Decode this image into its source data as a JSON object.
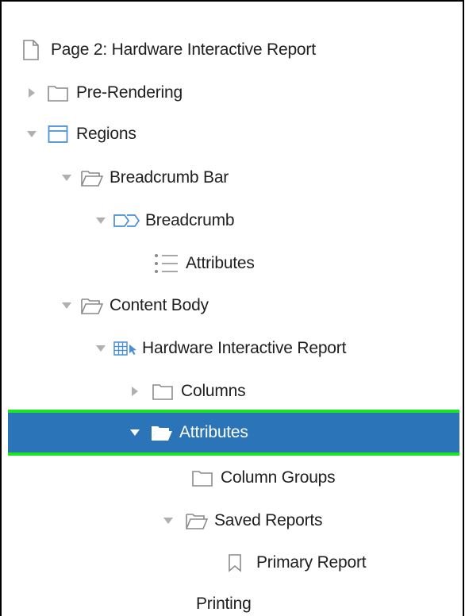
{
  "tree": {
    "nodes": [
      {
        "label": "Page 2: Hardware Interactive Report",
        "icon": "page-icon",
        "toggle": "none"
      },
      {
        "label": "Pre-Rendering",
        "icon": "folder-icon",
        "toggle": "collapsed"
      },
      {
        "label": "Regions",
        "icon": "region-icon",
        "toggle": "expanded"
      },
      {
        "label": "Breadcrumb Bar",
        "icon": "folder-open-icon",
        "toggle": "expanded"
      },
      {
        "label": "Breadcrumb",
        "icon": "breadcrumb-icon",
        "toggle": "expanded"
      },
      {
        "label": "Attributes",
        "icon": "list-icon",
        "toggle": "none"
      },
      {
        "label": "Content Body",
        "icon": "folder-open-icon",
        "toggle": "expanded"
      },
      {
        "label": "Hardware Interactive Report",
        "icon": "interactive-report-icon",
        "toggle": "expanded"
      },
      {
        "label": "Columns",
        "icon": "folder-icon",
        "toggle": "collapsed"
      },
      {
        "label": "Attributes",
        "icon": "folder-open-icon",
        "toggle": "expanded",
        "selected": true
      },
      {
        "label": "Column Groups",
        "icon": "folder-icon",
        "toggle": "none"
      },
      {
        "label": "Saved Reports",
        "icon": "folder-open-icon",
        "toggle": "expanded"
      },
      {
        "label": "Primary Report",
        "icon": "bookmark-icon",
        "toggle": "none"
      },
      {
        "label": "Printing",
        "icon": "",
        "toggle": "none"
      }
    ]
  },
  "colors": {
    "selected_background": "#2b74b8",
    "selected_outline": "#19e621",
    "icon_blue": "#4a90d9",
    "icon_gray": "#8a8a8a",
    "toggle_gray": "#b0b0b0"
  }
}
